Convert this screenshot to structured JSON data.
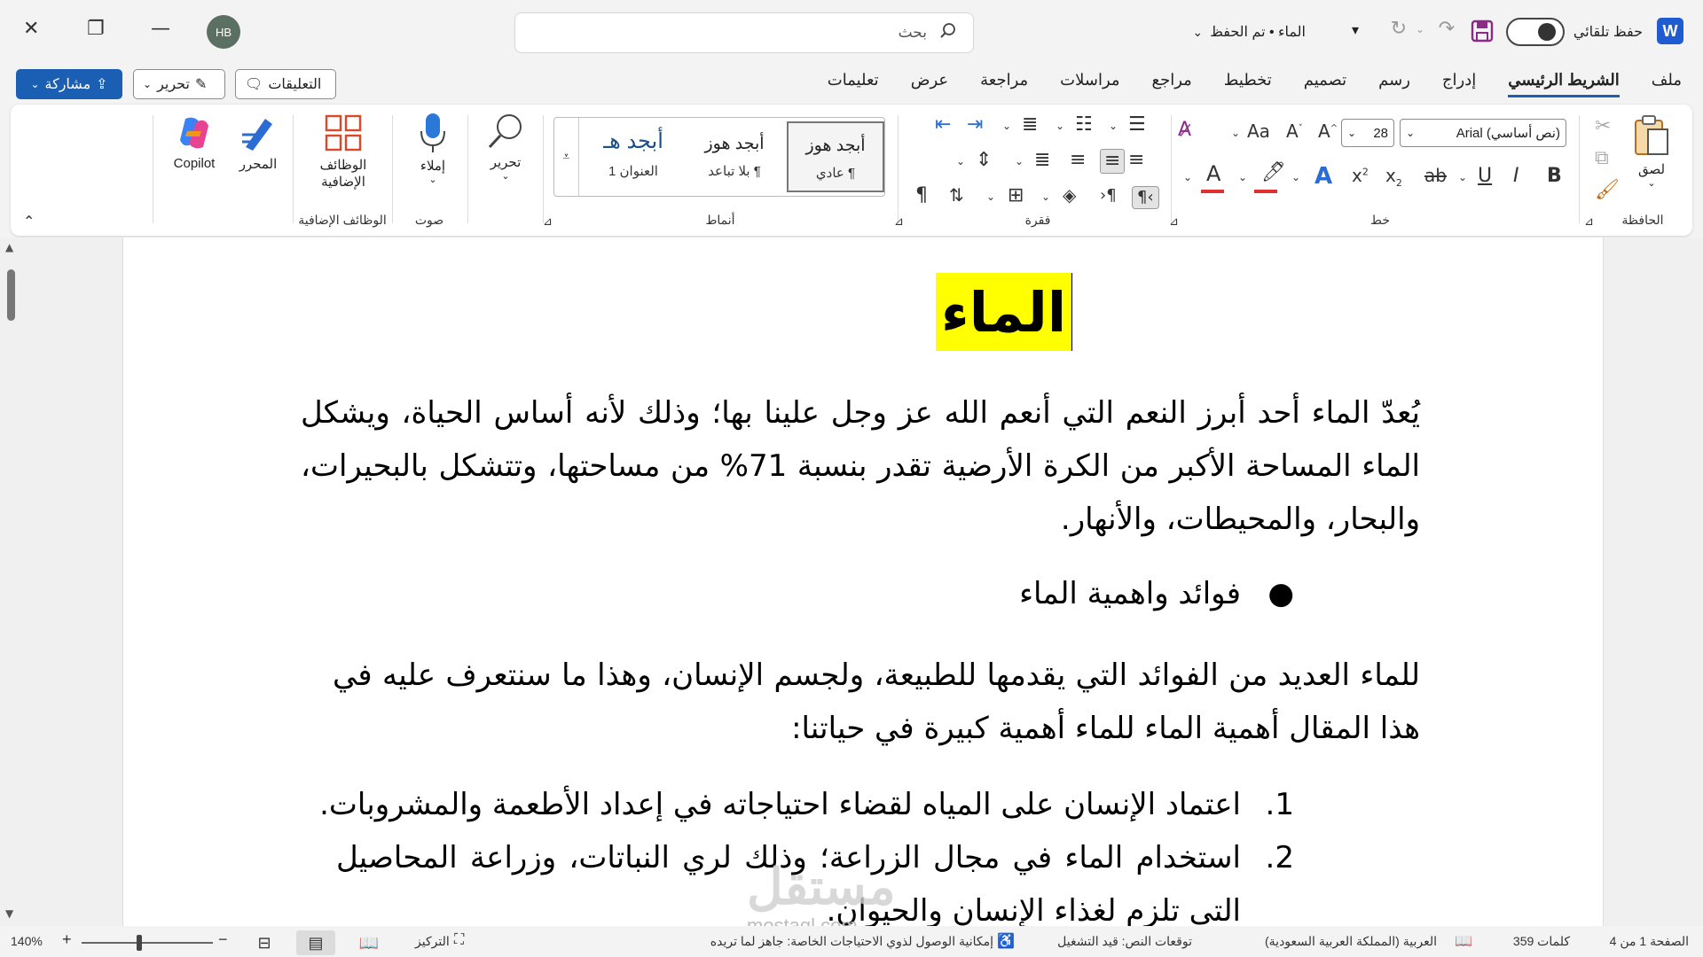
{
  "app": {
    "logo_letter": "W",
    "autosave_label": "حفظ تلقائي",
    "doc_title": "الماء • تم الحفظ",
    "search_placeholder": "بحث",
    "user_initials": "HB"
  },
  "tabs": [
    "ملف",
    "الشريط الرئيسي",
    "إدراج",
    "رسم",
    "تصميم",
    "تخطيط",
    "مراجع",
    "مراسلات",
    "مراجعة",
    "عرض",
    "تعليمات"
  ],
  "actions": {
    "comments": "التعليقات",
    "edit": "تحرير",
    "share": "مشاركة"
  },
  "ribbon": {
    "clipboard": {
      "label": "الحافظة",
      "paste": "لصق"
    },
    "font": {
      "label": "خط",
      "font_name": "Arial (نص أساسي)",
      "font_size": "28",
      "font_color": "#e03030",
      "highlight_color": "#e03030"
    },
    "paragraph": {
      "label": "فقرة"
    },
    "styles": {
      "label": "أنماط",
      "sample": "أبجد هوز",
      "sample_heading": "أبجد هـ",
      "items": [
        "عادي ¶",
        "بلا تباعد ¶",
        "العنوان 1"
      ]
    },
    "editing": {
      "label": "تحرير"
    },
    "voice": {
      "label": "صوت",
      "dictate": "إملاء"
    },
    "addins": {
      "label": "الوظائف الإضافية",
      "button": "الوظائف الإضافية"
    },
    "editor": {
      "label": "المحرر"
    },
    "copilot": {
      "label": "Copilot"
    }
  },
  "document": {
    "title": "الماء",
    "intro": "يُعدّ الماء أحد أبرز النعم التي أنعم الله عز وجل علينا بها؛ وذلك لأنه أساس الحياة، ويشكل الماء المساحة الأكبر من الكرة الأرضية تقدر بنسبة 71% من مساحتها، وتتشكل بالبحيرات، والبحار، والمحيطات، والأنهار.",
    "bullet": "فوائد واهمية الماء",
    "para2": "للماء العديد من الفوائد التي يقدمها للطبيعة، ولجسم الإنسان، وهذا ما سنتعرف عليه في هذا المقال أهمية الماء للماء أهمية كبيرة في حياتنا:",
    "list": [
      {
        "num": "1.",
        "text": "اعتماد الإنسان على المياه لقضاء احتياجاته في إعداد الأطعمة والمشروبات."
      },
      {
        "num": "2.",
        "text": "استخدام الماء في مجال الزراعة؛ وذلك لري النباتات، وزراعة المحاصيل التي تلزم لغذاء الإنسان والحيوان."
      }
    ],
    "watermark": "مستقل",
    "watermark_sub": "mostaql.com"
  },
  "status": {
    "page": "الصفحة 1 من 4",
    "words": "359 كلمات",
    "language": "العربية (المملكة العربية السعودية)",
    "predictions": "توقعات النص: قيد التشغيل",
    "accessibility": "إمكانية الوصول لذوي الاحتياجات الخاصة: جاهز لما تريده",
    "focus": "التركيز",
    "zoom": "140%"
  }
}
